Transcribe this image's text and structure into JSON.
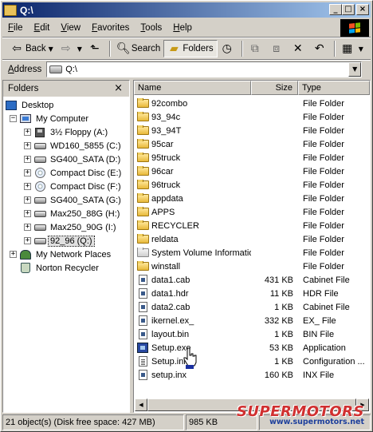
{
  "window": {
    "title": "Q:\\",
    "controls": {
      "minimize": "_",
      "maximize": "□",
      "close": "×"
    }
  },
  "menubar": {
    "items": [
      "File",
      "Edit",
      "View",
      "Favorites",
      "Tools",
      "Help"
    ]
  },
  "toolbar": {
    "back_label": "Back",
    "search_label": "Search",
    "folders_label": "Folders",
    "icons": [
      "back-arrow",
      "forward-arrow",
      "up-folder",
      "search",
      "folders",
      "history",
      "move-to",
      "copy-to",
      "delete",
      "undo",
      "views"
    ]
  },
  "address": {
    "label": "Address",
    "value": "Q:\\"
  },
  "folders_pane": {
    "title": "Folders",
    "close": "×",
    "tree": [
      {
        "label": "Desktop",
        "level": 0,
        "expander": "",
        "icon": "desktop-icon"
      },
      {
        "label": "My Computer",
        "level": 1,
        "expander": "−",
        "icon": "my-computer-icon"
      },
      {
        "label": "3½ Floppy (A:)",
        "level": 2,
        "expander": "+",
        "icon": "floppy-icon"
      },
      {
        "label": "WD160_5855 (C:)",
        "level": 2,
        "expander": "+",
        "icon": "drive-icon"
      },
      {
        "label": "SG400_SATA (D:)",
        "level": 2,
        "expander": "+",
        "icon": "drive-icon"
      },
      {
        "label": "Compact Disc (E:)",
        "level": 2,
        "expander": "+",
        "icon": "cd-icon"
      },
      {
        "label": "Compact Disc (F:)",
        "level": 2,
        "expander": "+",
        "icon": "cd-icon"
      },
      {
        "label": "SG400_SATA (G:)",
        "level": 2,
        "expander": "+",
        "icon": "drive-icon"
      },
      {
        "label": "Max250_88G (H:)",
        "level": 2,
        "expander": "+",
        "icon": "drive-icon"
      },
      {
        "label": "Max250_90G (I:)",
        "level": 2,
        "expander": "+",
        "icon": "drive-icon"
      },
      {
        "label": "92_96 (Q:)",
        "level": 2,
        "expander": "+",
        "icon": "drive-icon",
        "selected": true
      },
      {
        "label": "My Network Places",
        "level": 1,
        "expander": "+",
        "icon": "network-places-icon"
      },
      {
        "label": "Norton Recycler",
        "level": 1,
        "expander": "",
        "icon": "recycle-bin-icon"
      }
    ]
  },
  "files_pane": {
    "columns": {
      "name": "Name",
      "size": "Size",
      "type": "Type"
    },
    "rows": [
      {
        "name": "92combo",
        "size": "",
        "type": "File Folder",
        "icon": "folder-icon"
      },
      {
        "name": "93_94c",
        "size": "",
        "type": "File Folder",
        "icon": "folder-icon"
      },
      {
        "name": "93_94T",
        "size": "",
        "type": "File Folder",
        "icon": "folder-icon"
      },
      {
        "name": "95car",
        "size": "",
        "type": "File Folder",
        "icon": "folder-icon"
      },
      {
        "name": "95truck",
        "size": "",
        "type": "File Folder",
        "icon": "folder-icon"
      },
      {
        "name": "96car",
        "size": "",
        "type": "File Folder",
        "icon": "folder-icon"
      },
      {
        "name": "96truck",
        "size": "",
        "type": "File Folder",
        "icon": "folder-icon"
      },
      {
        "name": "appdata",
        "size": "",
        "type": "File Folder",
        "icon": "folder-icon"
      },
      {
        "name": "APPS",
        "size": "",
        "type": "File Folder",
        "icon": "folder-icon"
      },
      {
        "name": "RECYCLER",
        "size": "",
        "type": "File Folder",
        "icon": "folder-icon"
      },
      {
        "name": "reldata",
        "size": "",
        "type": "File Folder",
        "icon": "folder-icon"
      },
      {
        "name": "System Volume Information",
        "size": "",
        "type": "File Folder",
        "icon": "system-folder-icon"
      },
      {
        "name": "winstall",
        "size": "",
        "type": "File Folder",
        "icon": "folder-icon"
      },
      {
        "name": "data1.cab",
        "size": "431 KB",
        "type": "Cabinet File",
        "icon": "cabinet-file-icon"
      },
      {
        "name": "data1.hdr",
        "size": "11 KB",
        "type": "HDR File",
        "icon": "file-icon"
      },
      {
        "name": "data2.cab",
        "size": "1 KB",
        "type": "Cabinet File",
        "icon": "cabinet-file-icon"
      },
      {
        "name": "ikernel.ex_",
        "size": "332 KB",
        "type": "EX_ File",
        "icon": "file-icon"
      },
      {
        "name": "layout.bin",
        "size": "1 KB",
        "type": "BIN File",
        "icon": "file-icon"
      },
      {
        "name": "Setup.exe",
        "size": "53 KB",
        "type": "Application",
        "icon": "application-icon"
      },
      {
        "name": "Setup.ini",
        "size": "1 KB",
        "type": "Configuration ...",
        "icon": "config-file-icon"
      },
      {
        "name": "setup.inx",
        "size": "160 KB",
        "type": "INX File",
        "icon": "file-icon"
      }
    ]
  },
  "statusbar": {
    "objects": "21 object(s) (Disk free space: 427 MB)",
    "size": "985 KB"
  },
  "watermark": {
    "logo": "SUPERMOTORS",
    "url": "www.supermotors.net"
  },
  "colors": {
    "title_start": "#0a246a",
    "title_end": "#a6caf0",
    "chrome": "#d4d0c8",
    "watermark_red": "#d03030",
    "watermark_blue": "#1d3f9c"
  }
}
